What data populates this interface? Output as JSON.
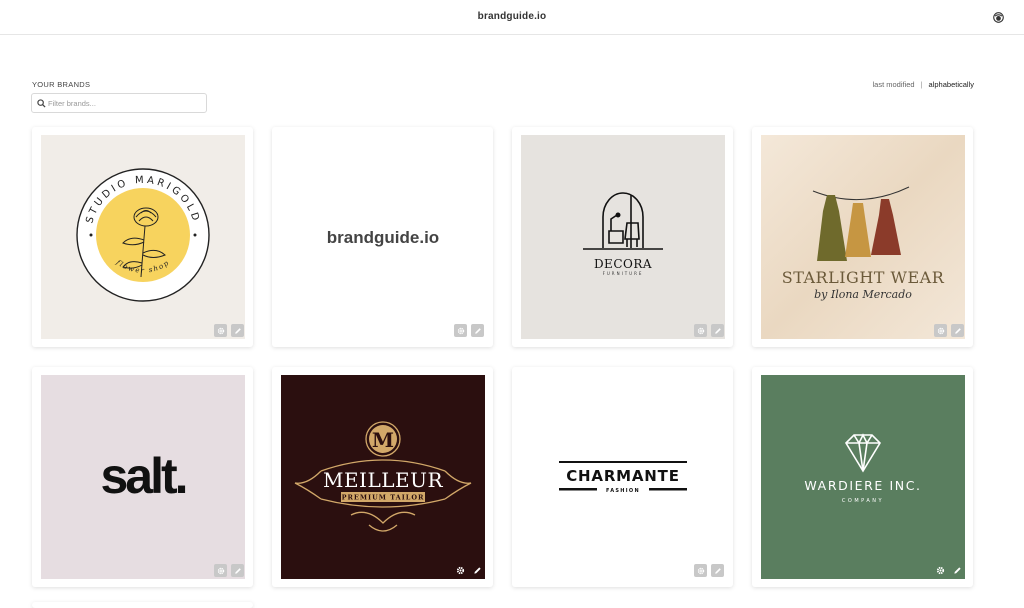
{
  "header": {
    "title": "brandguide.io",
    "user_icon": "user-avatar-icon"
  },
  "brands_section": {
    "label": "YOUR BRANDS",
    "search_placeholder": "Filter brands...",
    "sort": {
      "last_modified": "last modified",
      "separator": "|",
      "alphabetically": "alphabetically",
      "active": "alphabetically"
    }
  },
  "brands": [
    {
      "name": "Studio Marigold",
      "logo_top": "STUDIO MARIGOLD",
      "logo_bottom": "flower shop",
      "bg": "#f1ede8",
      "accent": "#f7d35e"
    },
    {
      "name": "brandguide.io",
      "logo_text": "brandguide.io",
      "bg": "#ffffff"
    },
    {
      "name": "Decora",
      "logo_text": "DECORA",
      "logo_sub": "FURNITURE",
      "bg": "#e6e3df"
    },
    {
      "name": "Starlight Wear",
      "logo_text": "STARLIGHT WEAR",
      "logo_sub": "by Ilona Mercado",
      "bg": "#efe3d3"
    },
    {
      "name": "salt.",
      "logo_text": "salt.",
      "bg": "#e6dde1"
    },
    {
      "name": "Meilleur",
      "logo_initial": "M",
      "logo_text": "MEILLEUR",
      "logo_sub": "PREMIUM TAILOR",
      "bg": "#2b0f0f",
      "accent": "#d2a869"
    },
    {
      "name": "Charmante",
      "logo_text": "CHARMANTE",
      "logo_sub": "FASHION",
      "bg": "#ffffff"
    },
    {
      "name": "Wardiere Inc.",
      "logo_text": "WARDIERE INC.",
      "logo_sub": "COMPANY",
      "bg": "#5a7e5f"
    }
  ],
  "card_actions": {
    "settings_icon": "gear-icon",
    "edit_icon": "pencil-icon"
  }
}
